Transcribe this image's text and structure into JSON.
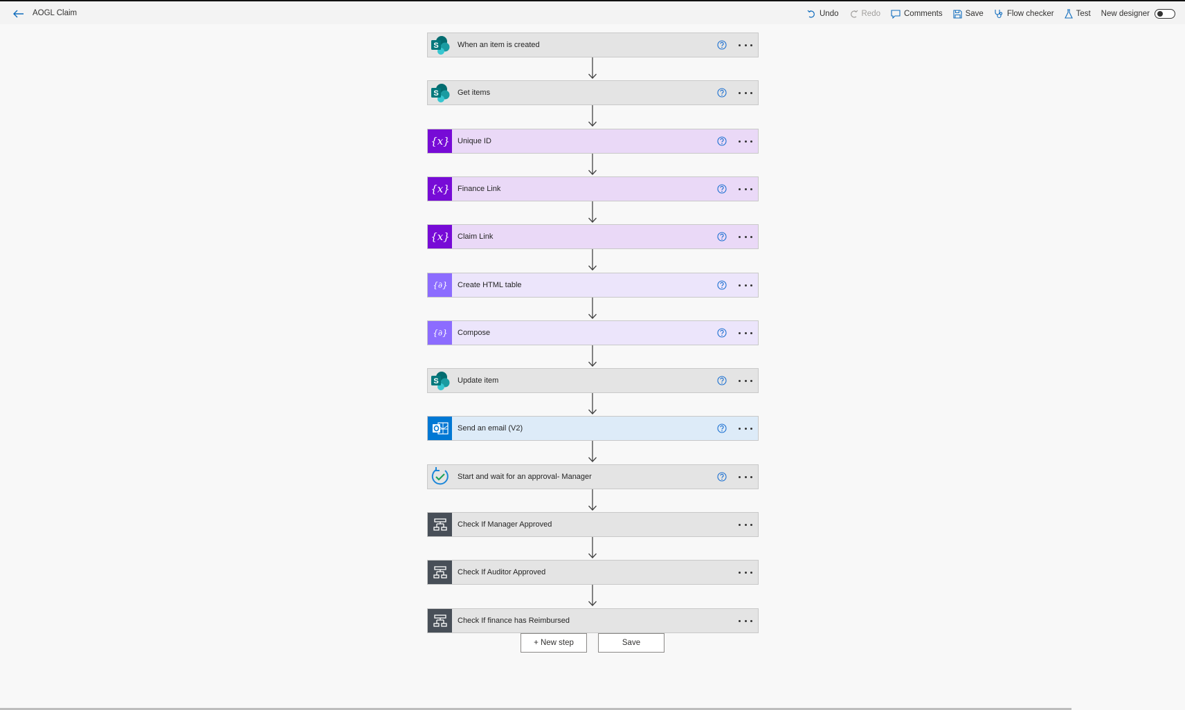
{
  "app": {
    "title": "AOGL Claim"
  },
  "toolbar": {
    "undo": "Undo",
    "redo": "Redo",
    "comments": "Comments",
    "save": "Save",
    "flow_checker": "Flow checker",
    "test": "Test",
    "new_designer": "New designer"
  },
  "steps": [
    {
      "label": "When an item is created",
      "icon": "sharepoint-icon",
      "type": "sharepoint",
      "help": true
    },
    {
      "label": "Get items",
      "icon": "sharepoint-icon",
      "type": "sharepoint",
      "help": true
    },
    {
      "label": "Unique ID",
      "icon": "variable-icon",
      "type": "variable",
      "help": true
    },
    {
      "label": "Finance Link",
      "icon": "variable-icon",
      "type": "variable",
      "help": true
    },
    {
      "label": "Claim Link",
      "icon": "variable-icon",
      "type": "variable",
      "help": true
    },
    {
      "label": "Create HTML table",
      "icon": "data-operation-icon",
      "type": "dataop",
      "help": true
    },
    {
      "label": "Compose",
      "icon": "data-operation-icon",
      "type": "dataop",
      "help": true
    },
    {
      "label": "Update item",
      "icon": "sharepoint-icon",
      "type": "sharepoint",
      "help": true
    },
    {
      "label": "Send an email (V2)",
      "icon": "outlook-icon",
      "type": "outlook",
      "help": true
    },
    {
      "label": "Start and wait for an approval- Manager",
      "icon": "approval-icon",
      "type": "approval",
      "help": true
    },
    {
      "label": "Check If Manager Approved",
      "icon": "condition-icon",
      "type": "condition",
      "help": false
    },
    {
      "label": "Check If Auditor Approved",
      "icon": "condition-icon",
      "type": "condition",
      "help": false
    },
    {
      "label": "Check If finance has Reimbursed",
      "icon": "condition-icon",
      "type": "condition",
      "help": false
    }
  ],
  "actions": {
    "new_step": "+ New step",
    "save": "Save"
  },
  "colors": {
    "sharepoint_card": "#e4e4e4",
    "variable_card": "#ead9f7",
    "variable_icon_bg": "#770bd6",
    "dataop_card": "#ece5fb",
    "dataop_icon_bg": "#8c6cff",
    "outlook_card": "#ddebf8",
    "outlook_icon_bg": "#0078d4",
    "condition_icon_bg": "#484f58",
    "help_icon": "#1a6fd1"
  }
}
